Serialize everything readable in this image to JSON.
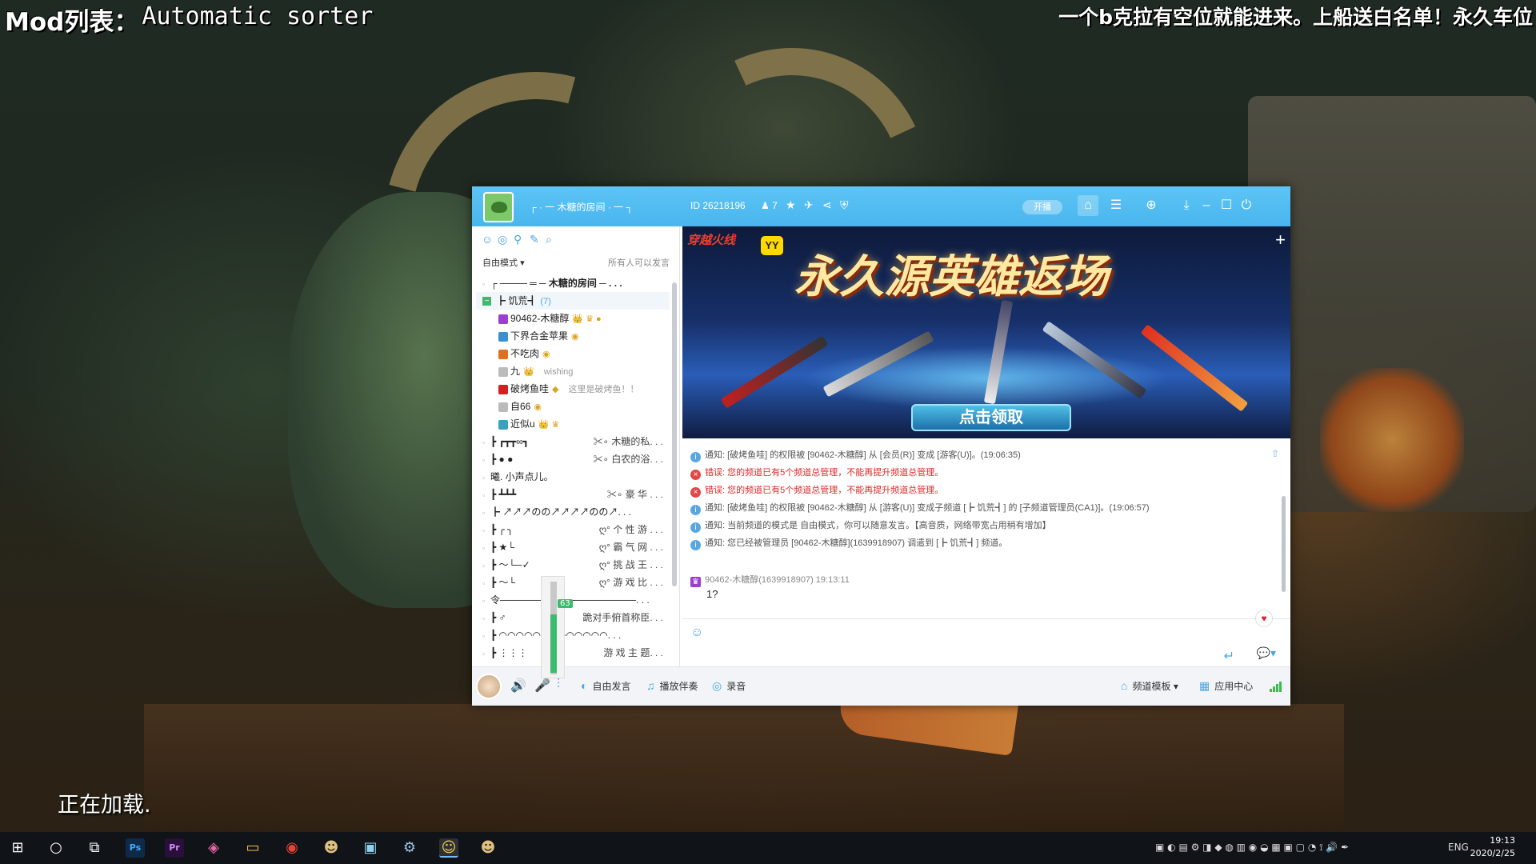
{
  "overlay": {
    "mod_prefix": "Mod列表：",
    "mod_name": "Automatic sorter",
    "banner": "一个b克拉有空位就能进来。上船送白名单！永久车位",
    "loading": "正在加载."
  },
  "window": {
    "room_name": "┌ ·  一  木糖的房间  ·  一  ┐",
    "room_id": "ID 26218196",
    "online_count": "7",
    "live_toggle": "开播"
  },
  "left_panel": {
    "mode": "自由模式",
    "mode_hint": "所有人可以发言",
    "tree": [
      {
        "type": "channel",
        "label": "┌ ──── ═ ─   木糖的房间   ─ . . ."
      },
      {
        "type": "channel-open",
        "label": "┣ 饥荒┫",
        "count": "(7)"
      },
      {
        "type": "user",
        "name": "90462-木糖醇",
        "color": "#9a3fd0",
        "badges": "👑 ♛ ●"
      },
      {
        "type": "user",
        "name": "下界合金苹果",
        "color": "#3a8fd0",
        "badges": "◉"
      },
      {
        "type": "user",
        "name": "不吃肉",
        "color": "#e07020",
        "badges": "◉"
      },
      {
        "type": "user",
        "name": "九",
        "color": "#bbbbbb",
        "badges": "👑",
        "signature": "wishing"
      },
      {
        "type": "user",
        "name": "破烤鱼哇",
        "color": "#d02020",
        "badges": "◆",
        "signature": "这里是破烤鱼！！"
      },
      {
        "type": "user",
        "name": "自66",
        "color": "#bbbbbb",
        "badges": "◉"
      },
      {
        "type": "user",
        "name": "近似u",
        "color": "#3aa0c0",
        "badges": "👑 ♛"
      },
      {
        "type": "channel",
        "label": "┣     ┏┳┳∞┓",
        "right": "✂∘ 木糖的私. . ."
      },
      {
        "type": "channel",
        "label": "┣        ● ●",
        "right": "✂∘ 白农的浴. . ."
      },
      {
        "type": "channel",
        "label": "曦. 小声点儿。"
      },
      {
        "type": "channel",
        "label": "┣       ┻┻┻",
        "right": "✂∘ 豪  华  . . ."
      },
      {
        "type": "channel",
        "label": "┣ ↗↗↗のの↗↗↗↗のの↗. . ."
      },
      {
        "type": "channel",
        "label": "┣      ╭ ╮",
        "right": "ღ° 个 性 游 . . ."
      },
      {
        "type": "channel",
        "label": "┣      ★└",
        "right": "ღ° 霸 气 网 . . ."
      },
      {
        "type": "channel",
        "label": "┣   ～└─✓",
        "right": "ღ° 挑 战 王 . . ."
      },
      {
        "type": "channel",
        "label": "┣   ～└",
        "right": "ღ° 游 戏 比 . . ."
      },
      {
        "type": "channel",
        "label": "令────────────────────. . ."
      },
      {
        "type": "channel",
        "label": "┣       ♂",
        "right": "跪对手俯首称臣. . ."
      },
      {
        "type": "channel",
        "label": "┣ ◠◠◠◠◠◠◠◠◠◠◠◠◠. . ."
      },
      {
        "type": "channel",
        "label": "┣  ⋮⋮⋮",
        "right": "游  戏  主  题. . ."
      }
    ]
  },
  "ad": {
    "game": "穿越火线",
    "badge": "YY",
    "title": "永久源英雄返场",
    "claim": "点击领取"
  },
  "chat": {
    "messages": [
      {
        "kind": "info",
        "text": "通知: [破烤鱼哇] 的权限被 [90462-木糖醇] 从 [会员(R)] 变成 [游客(U)]。(19:06:35)"
      },
      {
        "kind": "error",
        "text": "错误: 您的频道已有5个频道总管理，不能再提升频道总管理。"
      },
      {
        "kind": "error",
        "text": "错误: 您的频道已有5个频道总管理，不能再提升频道总管理。"
      },
      {
        "kind": "info",
        "text": "通知: [破烤鱼哇] 的权限被 [90462-木糖醇] 从 [游客(U)] 变成子频道 [┣ 饥荒┫] 的 [子频道管理员(CA1)]。(19:06:57)"
      },
      {
        "kind": "info",
        "text": "通知: 当前频道的模式是 自由模式，你可以随意发言。【高音质，网络带宽占用稍有增加】"
      },
      {
        "kind": "info",
        "text": "通知: 您已经被管理员 [90462-木糖醇](1639918907) 调遣到 [┣ 饥荒┫] 频道。"
      }
    ],
    "user_line": "90462-木糖醇(1639918907) 19:13:11",
    "user_text": "1?"
  },
  "bottom": {
    "free_speak": "自由发言",
    "play_music": "播放伴奏",
    "record": "录音",
    "template": "频道模板",
    "app_center": "应用中心"
  },
  "mic": {
    "level": 63,
    "label": "63"
  },
  "taskbar": {
    "lang": "ENG",
    "time": "19:13",
    "date": "2020/2/25"
  },
  "colors": {
    "title_bar": "#4ab8f0",
    "accent": "#4aa6e0",
    "error": "#e02828",
    "green": "#3cba6f"
  }
}
